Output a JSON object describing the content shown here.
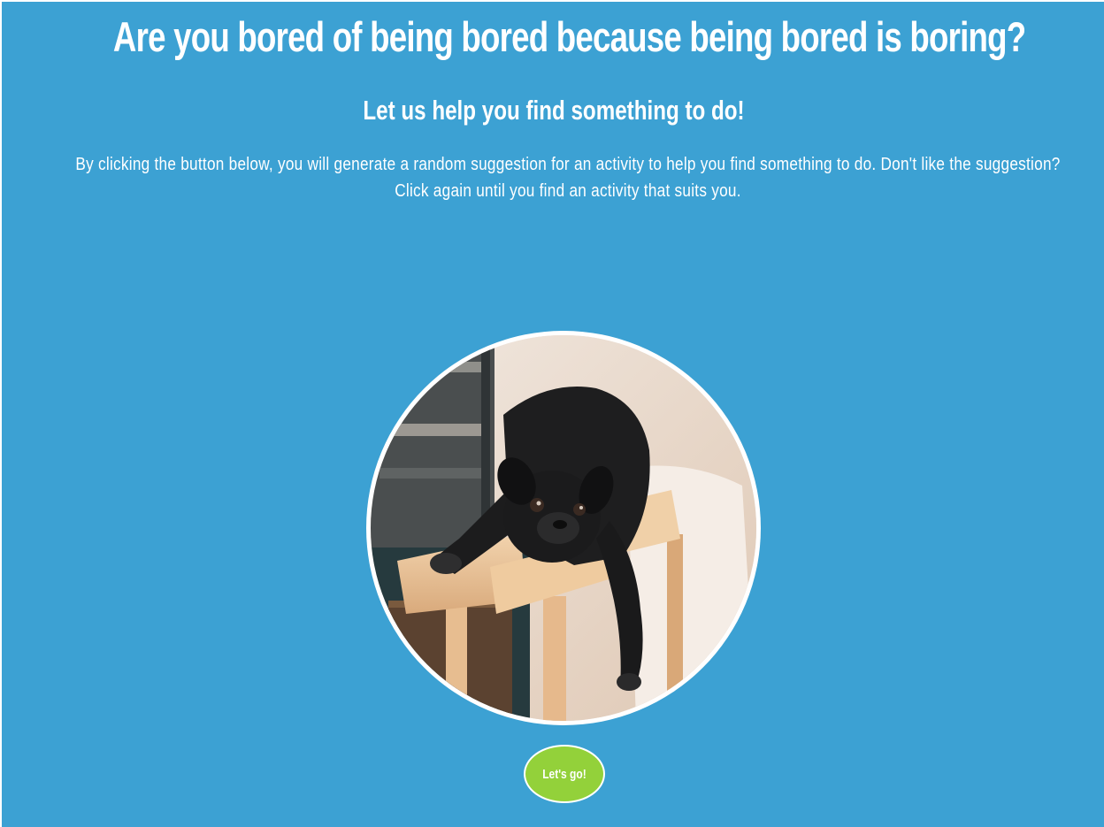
{
  "header": {
    "title": "Are you bored of being bored because being bored is boring?",
    "subtitle": "Let us help you find something to do!",
    "description": "By clicking the button below, you will generate a random suggestion for an activity to help you find something to do. Don't like the suggestion? Click again until you find an activity that suits you."
  },
  "hero": {
    "image": "bored-pug-on-bench-photo"
  },
  "action": {
    "button_label": "Let's go!"
  },
  "colors": {
    "background": "#3ca1d3",
    "button": "#93d13a",
    "text": "#ffffff"
  }
}
